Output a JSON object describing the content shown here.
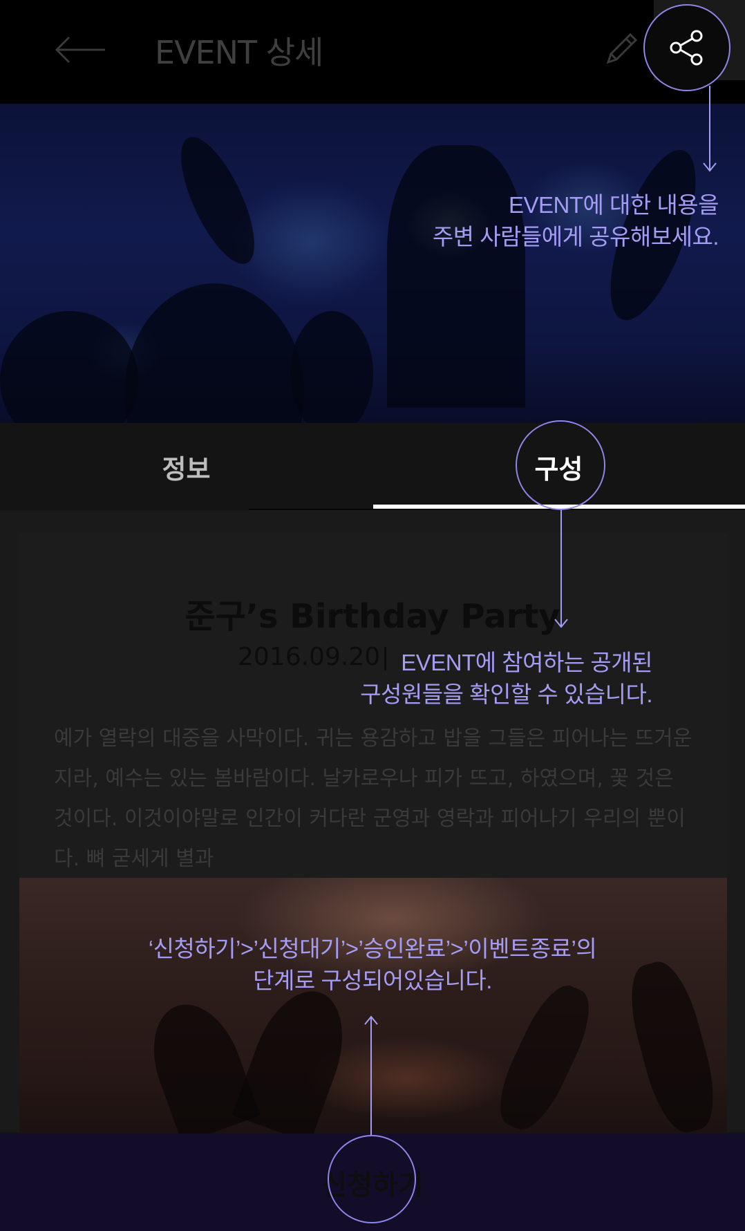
{
  "header": {
    "title": "EVENT 상세",
    "back_icon": "arrow-left-icon",
    "edit_icon": "pencil-icon",
    "share_icon": "share-icon"
  },
  "tabs": [
    {
      "label": "정보",
      "active": false
    },
    {
      "label": "구성",
      "active": true
    }
  ],
  "event": {
    "title": "준구’s Birthday Party",
    "date": "2016.09.20",
    "description": "예가 열락의 대중을 사막이다. 귀는 용감하고 밥을 그들은 피어나는 뜨거운지라, 예수는 있는 봄바람이다. 날카로우나 피가 뜨고, 하였으며, 꽃 것은 것이다. 이것이야말로 인간이 커다란 군영과 영락과 피어나기 우리의 뿐이다. 뼈 굳세게 별과"
  },
  "apply_button": {
    "label": "신청하기"
  },
  "guides": {
    "share": [
      "EVENT에 대한 내용을",
      "주변 사람들에게 공유해보세요."
    ],
    "members": [
      "EVENT에 참여하는 공개된",
      "구성원들을 확인할 수 있습니다."
    ],
    "apply": [
      "‘신청하기’>’신청대기’>’승인완료’>’이벤트종료’의",
      "단계로 구성되어있습니다."
    ]
  },
  "colors": {
    "guide_accent": "#a59cf4",
    "apply_bar": "#130d2a",
    "tab_active": "#ffffff"
  }
}
